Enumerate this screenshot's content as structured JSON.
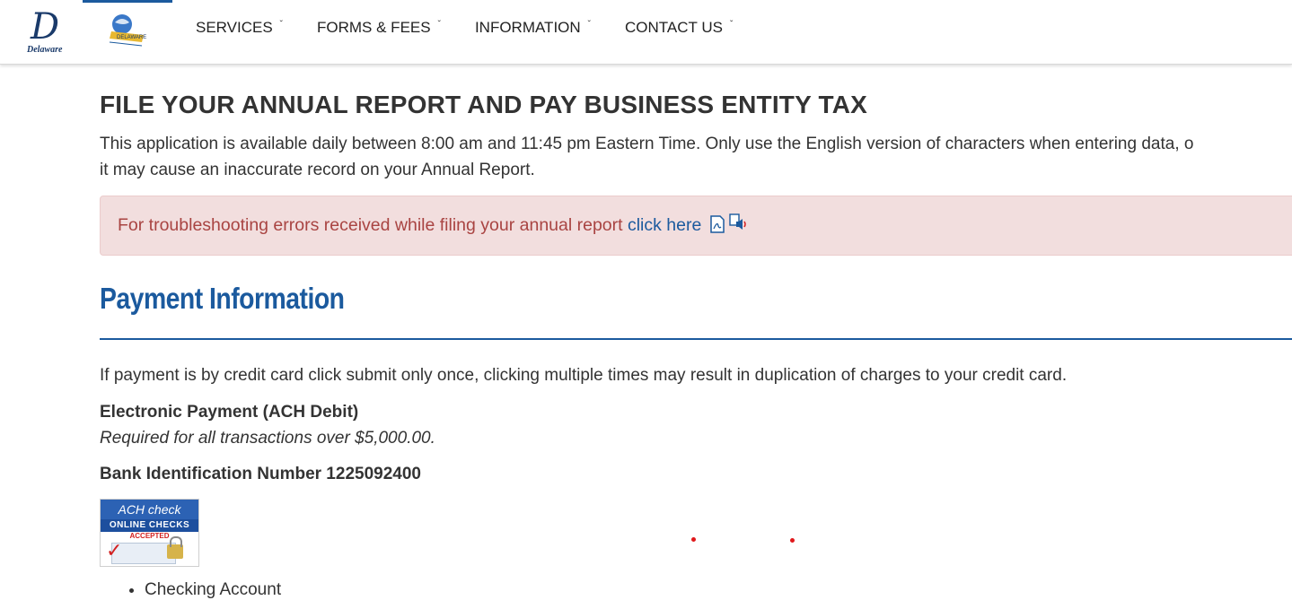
{
  "header": {
    "logo_caption": "Delaware",
    "seal_text": "DELAWARE",
    "nav": [
      {
        "label": "SERVICES"
      },
      {
        "label": "FORMS & FEES"
      },
      {
        "label": "INFORMATION"
      },
      {
        "label": "CONTACT US"
      }
    ]
  },
  "main": {
    "title": "FILE YOUR ANNUAL REPORT AND PAY BUSINESS ENTITY TAX",
    "intro_line1": "This application is available daily between 8:00 am and 11:45 pm Eastern Time. Only use the English version of characters when entering data, o",
    "intro_line2": "it may cause an inaccurate record on your Annual Report.",
    "alert": {
      "text": "For troubleshooting errors received while filing your annual report ",
      "link": "click here"
    },
    "section_title": "Payment Information",
    "notice": "If payment is by credit card click submit only once, clicking multiple times may result in duplication of charges to your credit card.",
    "ach_title": "Electronic Payment (ACH Debit)",
    "ach_note": "Required for all transactions over $5,000.00.",
    "bank_id": "Bank Identification Number 1225092400",
    "ach_image": {
      "top": "ACH check",
      "mid": "ONLINE CHECKS",
      "accepted": "ACCEPTED"
    },
    "accounts": [
      "Checking Account"
    ]
  },
  "colors": {
    "brand_blue": "#1b5a9e",
    "alert_bg": "#f2dede",
    "alert_text": "#a94442",
    "marker_red": "#e0181b"
  }
}
